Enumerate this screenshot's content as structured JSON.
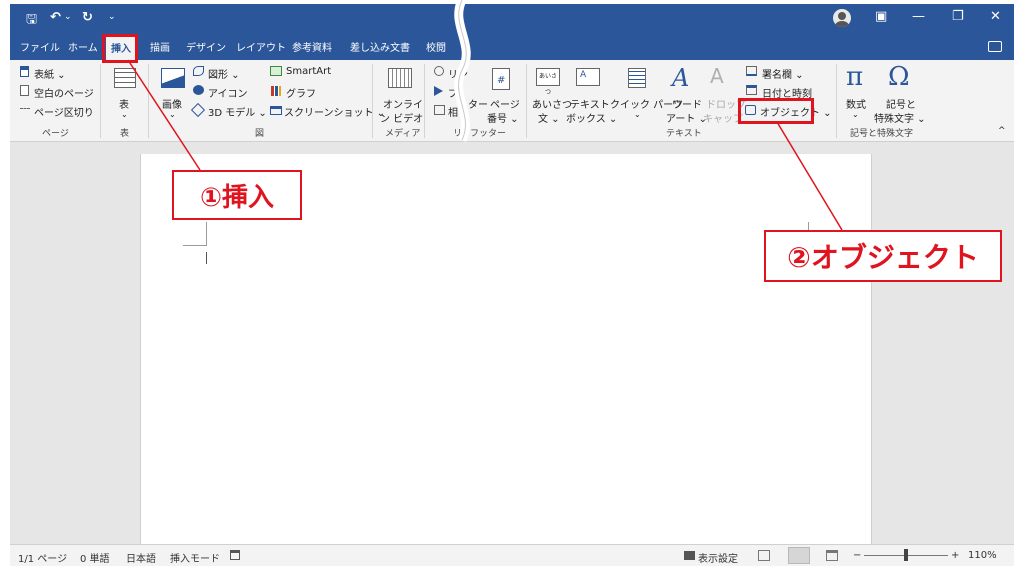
{
  "titlebar": {
    "qat_save": "🖫",
    "qat_undo": "↶",
    "qat_undo_drop": "⌄",
    "qat_redo": "↻",
    "qat_custom": "⌄",
    "ribbon_display_icon": "▣",
    "minimize": "—",
    "restore": "❐",
    "close": "✕"
  },
  "tabs": [
    "ファイル",
    "ホーム",
    "挿入",
    "描画",
    "デザイン",
    "レイアウト",
    "参考資料",
    "差し込み文書",
    "校閲"
  ],
  "ribbon": {
    "pages": {
      "cover": "表紙 ⌄",
      "blank": "空白のページ",
      "break": "ページ区切り",
      "group": "ページ"
    },
    "table": {
      "label": "表",
      "drop": "⌄",
      "group": "表"
    },
    "illustrations": {
      "pictures": "画像",
      "pictures_drop": "⌄",
      "shapes": "図形 ⌄",
      "icons": "アイコン",
      "models": "3D モデル ⌄",
      "smartart": "SmartArt",
      "chart": "グラフ",
      "screenshot": "スクリーンショット ⌄",
      "group": "図"
    },
    "media": {
      "online_video_1": "オンライ",
      "online_video_2": "ン ビデオ",
      "group": "メディア"
    },
    "links": {
      "link": "リン",
      "bookmark": "ブ",
      "cross_ref": "相"
    },
    "header_footer": {
      "header_frag": "ター",
      "page_number_1": "ページ",
      "page_number_2": "番号 ⌄",
      "group_frag": "フッター",
      "group_prefix": "リ"
    },
    "text": {
      "greeting_1": "あいさつ",
      "greeting_2": "文 ⌄",
      "textbox_1": "テキスト",
      "textbox_2": "ボックス ⌄",
      "quickparts_1": "クイック パーツ",
      "quickparts_2": "⌄",
      "wordart_1": "ワード",
      "wordart_2": "アート ⌄",
      "dropcap_1": "ドロップ",
      "dropcap_2": "キャップ",
      "signature": "署名欄 ⌄",
      "datetime": "日付と時刻",
      "object": "オブジェクト ⌄",
      "group": "テキスト",
      "greeting_icon_text": "あいさつ"
    },
    "symbols": {
      "equation_1": "数式",
      "equation_2": "⌄",
      "symbol_1": "記号と",
      "symbol_2": "特殊文字 ⌄",
      "group": "記号と特殊文字",
      "pi": "π",
      "omega": "Ω"
    },
    "collapse": "^"
  },
  "status": {
    "page": "1/1 ページ",
    "words": "0 単語",
    "lang": "日本語",
    "mode": "挿入モード",
    "display_settings": "表示設定",
    "zoom_minus": "−",
    "zoom_plus": "+",
    "zoom": "110%"
  },
  "annotations": {
    "step1": "①挿入",
    "step2": "②オブジェクト"
  },
  "colors": {
    "accent": "#2b579a",
    "annotation": "#e0141e"
  }
}
